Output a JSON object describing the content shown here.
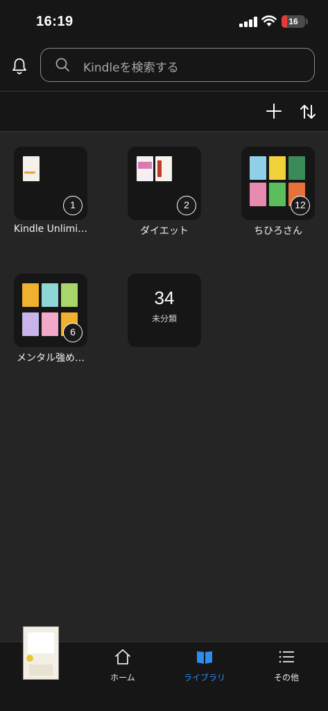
{
  "status_bar": {
    "time": "16:19",
    "battery": "16",
    "battery_color": "#e63a3a"
  },
  "search": {
    "placeholder": "Kindleを検索する"
  },
  "toolbar": {
    "add_icon": "plus-icon",
    "sort_icon": "sort-icon"
  },
  "collections": [
    {
      "label": "Kindle Unlimi…",
      "count": "1"
    },
    {
      "label": "ダイエット",
      "count": "2"
    },
    {
      "label": "ちひろさん",
      "count": "12"
    },
    {
      "label": "メンタル強め…",
      "count": "6"
    }
  ],
  "uncategorized": {
    "count": "34",
    "label": "未分類"
  },
  "bottom_nav": [
    {
      "label": "ホーム",
      "icon": "home-icon"
    },
    {
      "label": "ライブラリ",
      "icon": "book-icon",
      "active": true
    },
    {
      "label": "その他",
      "icon": "menu-icon"
    }
  ],
  "accent_color": "#2d8cf0"
}
